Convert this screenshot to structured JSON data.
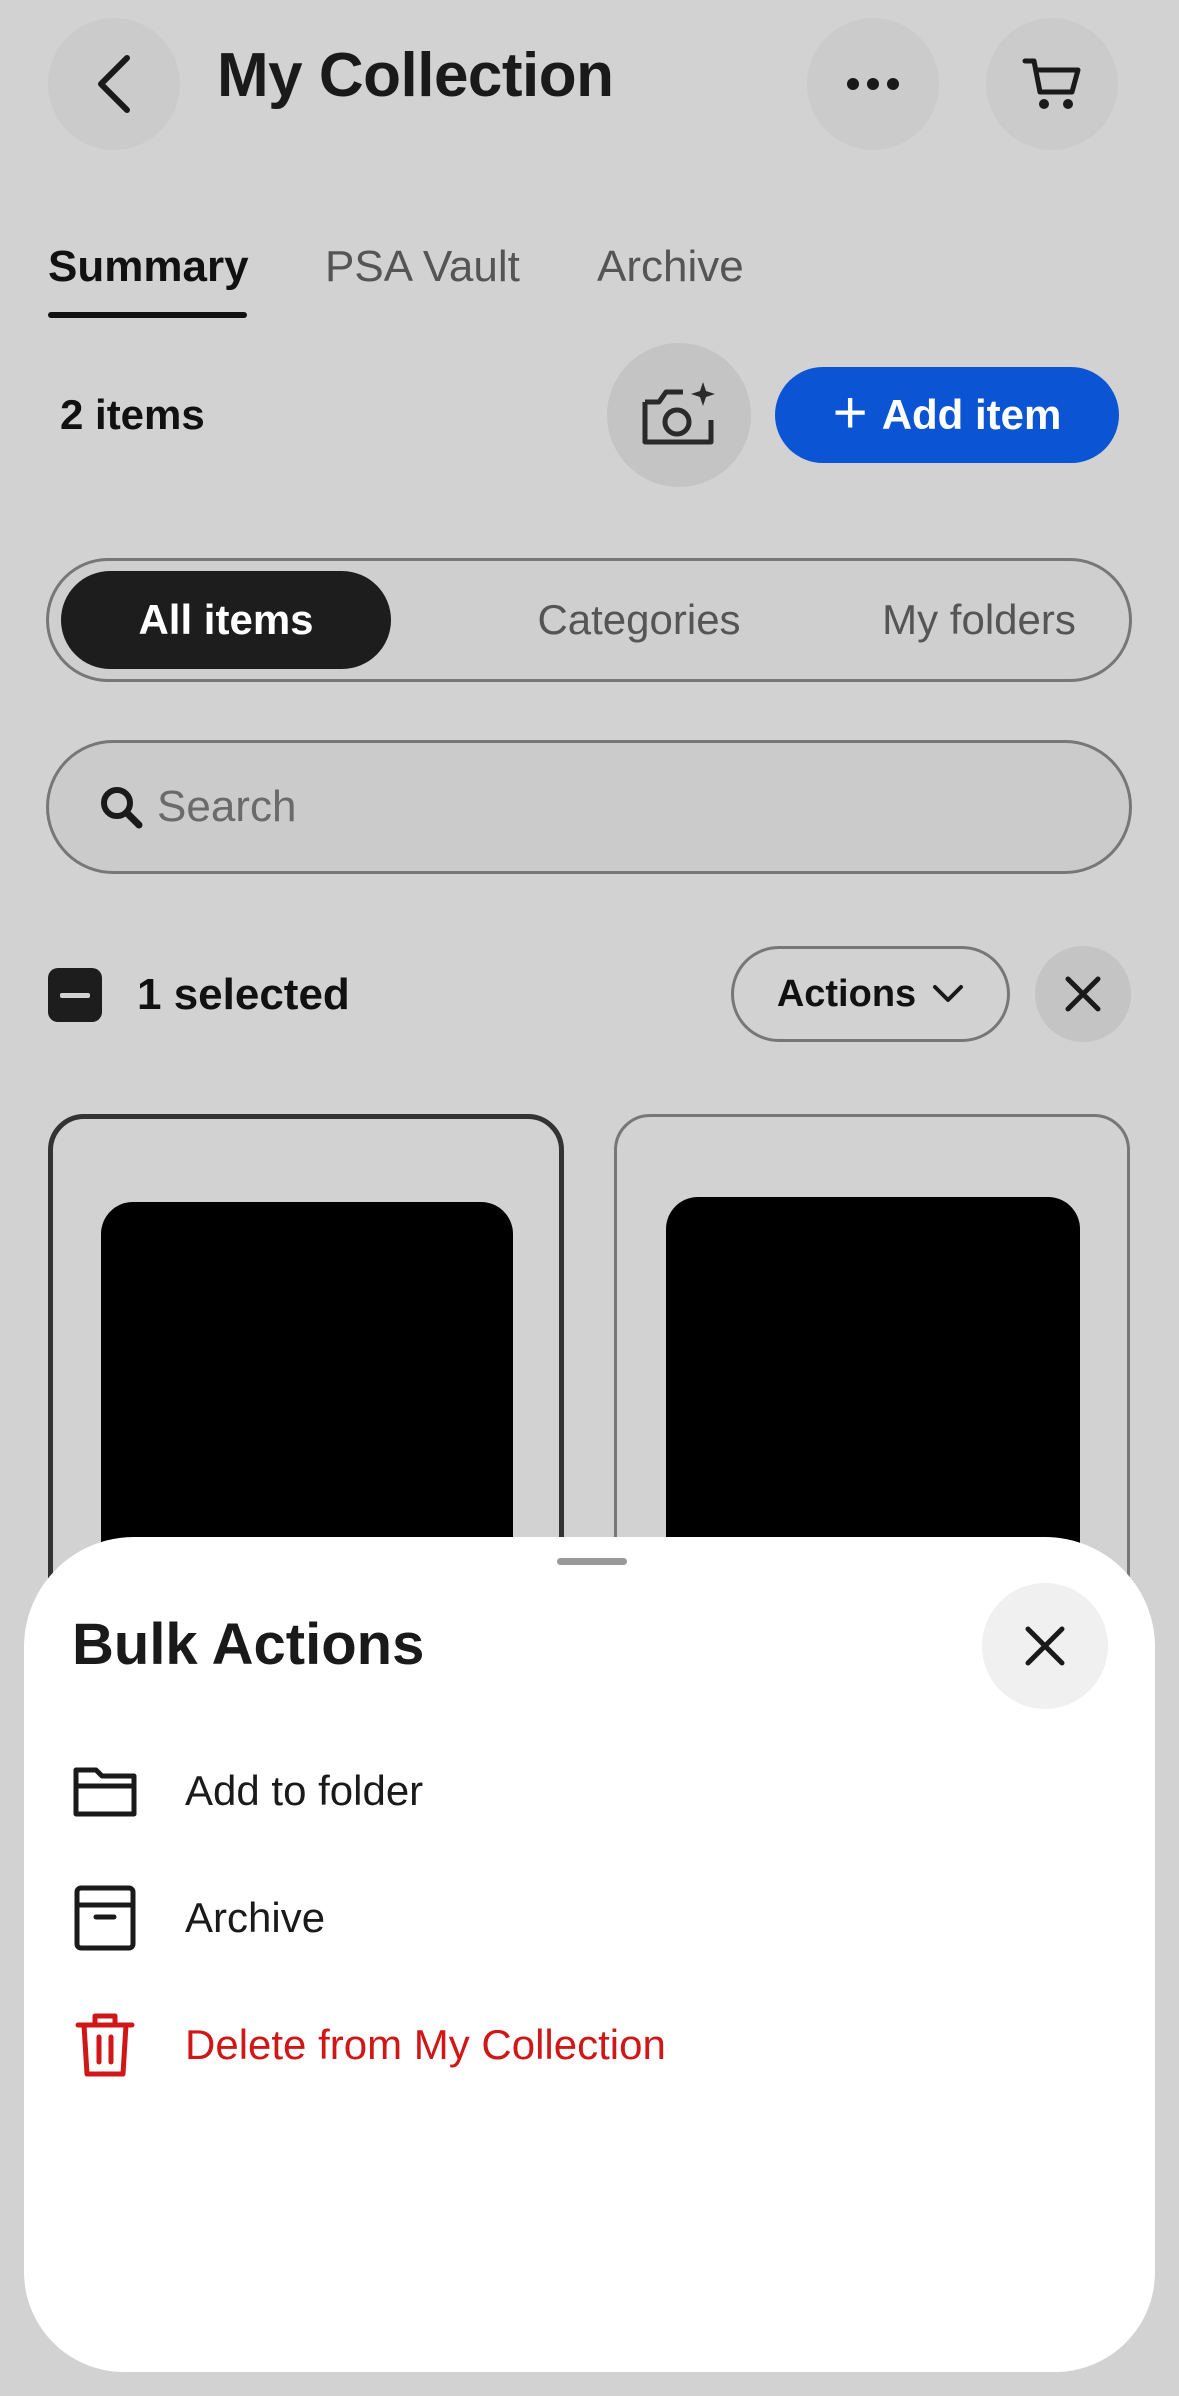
{
  "header": {
    "title": "My Collection",
    "back_icon": "chevron-left-icon",
    "more_icon": "more-horizontal-icon",
    "cart_icon": "cart-icon"
  },
  "tabs": [
    {
      "label": "Summary",
      "active": true
    },
    {
      "label": "PSA Vault",
      "active": false
    },
    {
      "label": "Archive",
      "active": false
    }
  ],
  "summary": {
    "items_count": "2 items",
    "camera_icon": "camera-sparkle-icon",
    "add_item_label": "Add item",
    "add_item_color": "#0b55d4"
  },
  "segments": [
    {
      "label": "All items",
      "active": true
    },
    {
      "label": "Categories",
      "active": false
    },
    {
      "label": "My folders",
      "active": false
    }
  ],
  "search": {
    "placeholder": "Search",
    "value": ""
  },
  "selection": {
    "selected_count": "1 selected",
    "actions_label": "Actions"
  },
  "bulk_actions": {
    "title": "Bulk Actions",
    "items": [
      {
        "label": "Add to folder",
        "icon": "folder-icon"
      },
      {
        "label": "Archive",
        "icon": "archive-box-icon"
      },
      {
        "label": "Delete from My Collection",
        "icon": "trash-icon",
        "color": "#d01616"
      }
    ]
  }
}
